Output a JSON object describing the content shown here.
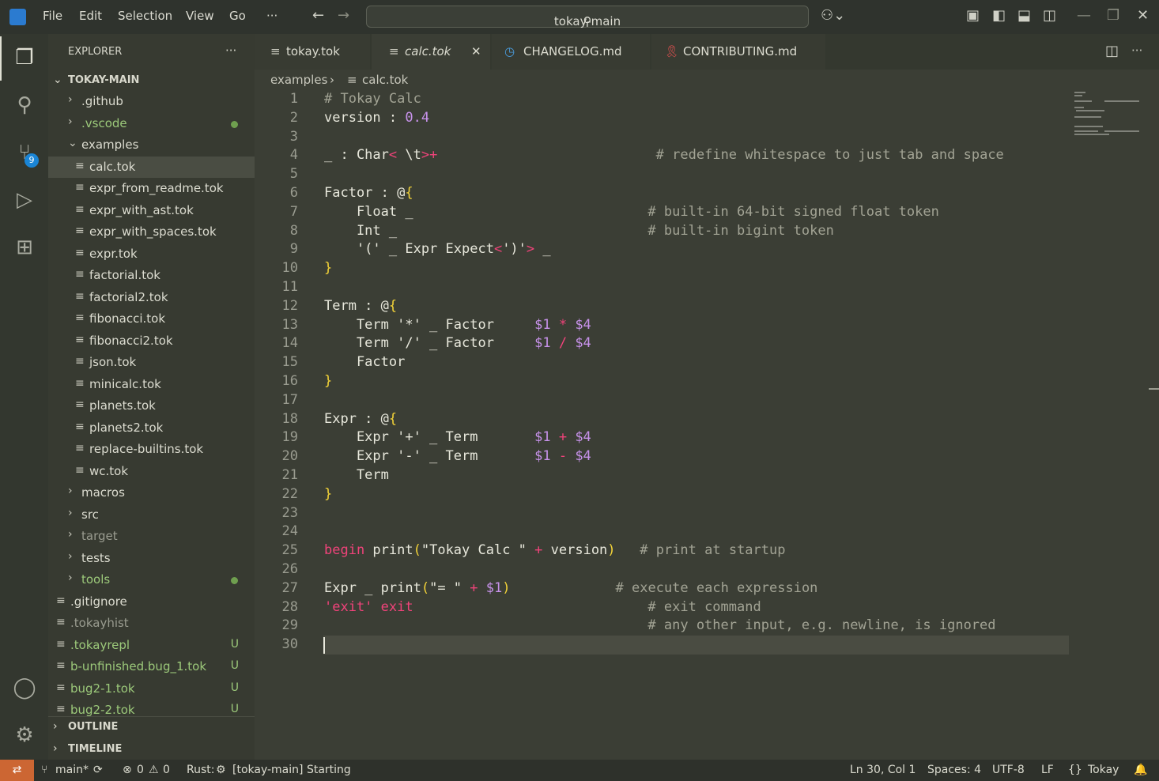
{
  "titlebar": {
    "menu": [
      "File",
      "Edit",
      "Selection",
      "View",
      "Go",
      "···"
    ],
    "search_text": "tokay-main"
  },
  "activity": {
    "scm_badge": "9"
  },
  "explorer": {
    "header": "EXPLORER",
    "more": "···",
    "root": "TOKAY-MAIN",
    "items": [
      {
        "label": ".github",
        "type": "folder",
        "open": false,
        "color": "#dcdcd0",
        "mark": ""
      },
      {
        "label": ".vscode",
        "type": "folder",
        "open": false,
        "color": "#9cc97a",
        "mark": "dot"
      },
      {
        "label": "examples",
        "type": "folder",
        "open": true,
        "color": "#dcdcd0",
        "mark": ""
      },
      {
        "label": "calc.tok",
        "type": "file",
        "color": "#dcdcd0",
        "mark": "",
        "selected": true
      },
      {
        "label": "expr_from_readme.tok",
        "type": "file",
        "color": "#dcdcd0",
        "mark": ""
      },
      {
        "label": "expr_with_ast.tok",
        "type": "file",
        "color": "#dcdcd0",
        "mark": ""
      },
      {
        "label": "expr_with_spaces.tok",
        "type": "file",
        "color": "#dcdcd0",
        "mark": ""
      },
      {
        "label": "expr.tok",
        "type": "file",
        "color": "#dcdcd0",
        "mark": ""
      },
      {
        "label": "factorial.tok",
        "type": "file",
        "color": "#dcdcd0",
        "mark": ""
      },
      {
        "label": "factorial2.tok",
        "type": "file",
        "color": "#dcdcd0",
        "mark": ""
      },
      {
        "label": "fibonacci.tok",
        "type": "file",
        "color": "#dcdcd0",
        "mark": ""
      },
      {
        "label": "fibonacci2.tok",
        "type": "file",
        "color": "#dcdcd0",
        "mark": ""
      },
      {
        "label": "json.tok",
        "type": "file",
        "color": "#dcdcd0",
        "mark": ""
      },
      {
        "label": "minicalc.tok",
        "type": "file",
        "color": "#dcdcd0",
        "mark": ""
      },
      {
        "label": "planets.tok",
        "type": "file",
        "color": "#dcdcd0",
        "mark": ""
      },
      {
        "label": "planets2.tok",
        "type": "file",
        "color": "#dcdcd0",
        "mark": ""
      },
      {
        "label": "replace-builtins.tok",
        "type": "file",
        "color": "#dcdcd0",
        "mark": ""
      },
      {
        "label": "wc.tok",
        "type": "file",
        "color": "#dcdcd0",
        "mark": ""
      },
      {
        "label": "macros",
        "type": "folder",
        "open": false,
        "color": "#dcdcd0",
        "mark": ""
      },
      {
        "label": "src",
        "type": "folder",
        "open": false,
        "color": "#dcdcd0",
        "mark": ""
      },
      {
        "label": "target",
        "type": "folder",
        "open": false,
        "color": "#9a9c90",
        "mark": ""
      },
      {
        "label": "tests",
        "type": "folder",
        "open": false,
        "color": "#dcdcd0",
        "mark": ""
      },
      {
        "label": "tools",
        "type": "folder",
        "open": false,
        "color": "#9cc97a",
        "mark": "dot"
      },
      {
        "label": ".gitignore",
        "type": "file",
        "color": "#dcdcd0",
        "mark": ""
      },
      {
        "label": ".tokayhist",
        "type": "file",
        "color": "#9a9c90",
        "mark": ""
      },
      {
        "label": ".tokayrepl",
        "type": "file",
        "color": "#9cc97a",
        "mark": "U"
      },
      {
        "label": "b-unfinished.bug_1.tok",
        "type": "file",
        "color": "#9cc97a",
        "mark": "U"
      },
      {
        "label": "bug2-1.tok",
        "type": "file",
        "color": "#9cc97a",
        "mark": "U"
      },
      {
        "label": "bug2-2.tok",
        "type": "file",
        "color": "#9cc97a",
        "mark": "U"
      }
    ],
    "outline": "OUTLINE",
    "timeline": "TIMELINE"
  },
  "tabs": [
    {
      "label": "tokay.tok",
      "icon": "file-lines-icon"
    },
    {
      "label": "calc.tok",
      "icon": "file-lines-icon",
      "active": true,
      "close": "✕"
    },
    {
      "label": "CHANGELOG.md",
      "icon": "clock-icon"
    },
    {
      "label": "CONTRIBUTING.md",
      "icon": "ribbon-icon"
    }
  ],
  "breadcrumb": {
    "folder": "examples",
    "sep": "›",
    "file": "calc.tok"
  },
  "code": [
    [
      [
        "# Tokay Calc",
        "com"
      ]
    ],
    [
      [
        "version : ",
        ""
      ],
      [
        "0.4",
        "num"
      ]
    ],
    [
      [
        "",
        ""
      ]
    ],
    [
      [
        "_ : Char",
        ""
      ],
      [
        "<",
        "op"
      ],
      [
        " \\t",
        ""
      ],
      [
        ">+",
        "op"
      ],
      [
        "                           # redefine whitespace to just tab and space",
        "com"
      ]
    ],
    [
      [
        "",
        ""
      ]
    ],
    [
      [
        "Factor : @",
        ""
      ],
      [
        "{",
        "br"
      ]
    ],
    [
      [
        "    Float _                             ",
        ""
      ],
      [
        "# built-in 64-bit signed float token",
        "com"
      ]
    ],
    [
      [
        "    Int _                               ",
        ""
      ],
      [
        "# built-in bigint token",
        "com"
      ]
    ],
    [
      [
        "    '(' _ Expr Expect",
        ""
      ],
      [
        "<",
        "op"
      ],
      [
        "')'",
        ""
      ],
      [
        ">",
        "op"
      ],
      [
        " _",
        ""
      ]
    ],
    [
      [
        "}",
        "br"
      ]
    ],
    [
      [
        "",
        ""
      ]
    ],
    [
      [
        "Term : @",
        ""
      ],
      [
        "{",
        "br"
      ]
    ],
    [
      [
        "    Term '*' _ Factor     ",
        ""
      ],
      [
        "$1",
        "var"
      ],
      [
        " * ",
        "op"
      ],
      [
        "$4",
        "var"
      ]
    ],
    [
      [
        "    Term '/' _ Factor     ",
        ""
      ],
      [
        "$1",
        "var"
      ],
      [
        " / ",
        "op"
      ],
      [
        "$4",
        "var"
      ]
    ],
    [
      [
        "    Factor",
        ""
      ]
    ],
    [
      [
        "}",
        "br"
      ]
    ],
    [
      [
        "",
        ""
      ]
    ],
    [
      [
        "Expr : @",
        ""
      ],
      [
        "{",
        "br"
      ]
    ],
    [
      [
        "    Expr '+' _ Term       ",
        ""
      ],
      [
        "$1",
        "var"
      ],
      [
        " + ",
        "op"
      ],
      [
        "$4",
        "var"
      ]
    ],
    [
      [
        "    Expr '-' _ Term       ",
        ""
      ],
      [
        "$1",
        "var"
      ],
      [
        " - ",
        "op"
      ],
      [
        "$4",
        "var"
      ]
    ],
    [
      [
        "    Term",
        ""
      ]
    ],
    [
      [
        "}",
        "br"
      ]
    ],
    [
      [
        "",
        ""
      ]
    ],
    [
      [
        "",
        ""
      ]
    ],
    [
      [
        "begin",
        "kw"
      ],
      [
        " print",
        ""
      ],
      [
        "(",
        "br"
      ],
      [
        "\"Tokay Calc \"",
        ""
      ],
      [
        " + ",
        "op"
      ],
      [
        "version",
        ""
      ],
      [
        ")",
        "br"
      ],
      [
        "   # print at startup",
        "com"
      ]
    ],
    [
      [
        "",
        ""
      ]
    ],
    [
      [
        "Expr _ print",
        ""
      ],
      [
        "(",
        "br"
      ],
      [
        "\"= \"",
        ""
      ],
      [
        " + ",
        "op"
      ],
      [
        "$1",
        "var"
      ],
      [
        ")",
        "br"
      ],
      [
        "             # execute each expression",
        "com"
      ]
    ],
    [
      [
        "'exit'",
        "kw"
      ],
      [
        " exit",
        "kw"
      ],
      [
        "                             # exit command",
        "com"
      ]
    ],
    [
      [
        "                                        ",
        ""
      ],
      [
        "# any other input, e.g. newline, is ignored",
        "com"
      ]
    ],
    [
      [
        "",
        ""
      ]
    ]
  ],
  "status": {
    "remote": "⇄",
    "branch": "main*",
    "sync": "⟳",
    "errors": "0",
    "warnings": "0",
    "rust": "Rust:",
    "rust_status": "[tokay-main] Starting",
    "position": "Ln 30, Col 1",
    "spaces": "Spaces: 4",
    "encoding": "UTF-8",
    "eol": "LF",
    "language": "Tokay",
    "bell": "🔔"
  }
}
